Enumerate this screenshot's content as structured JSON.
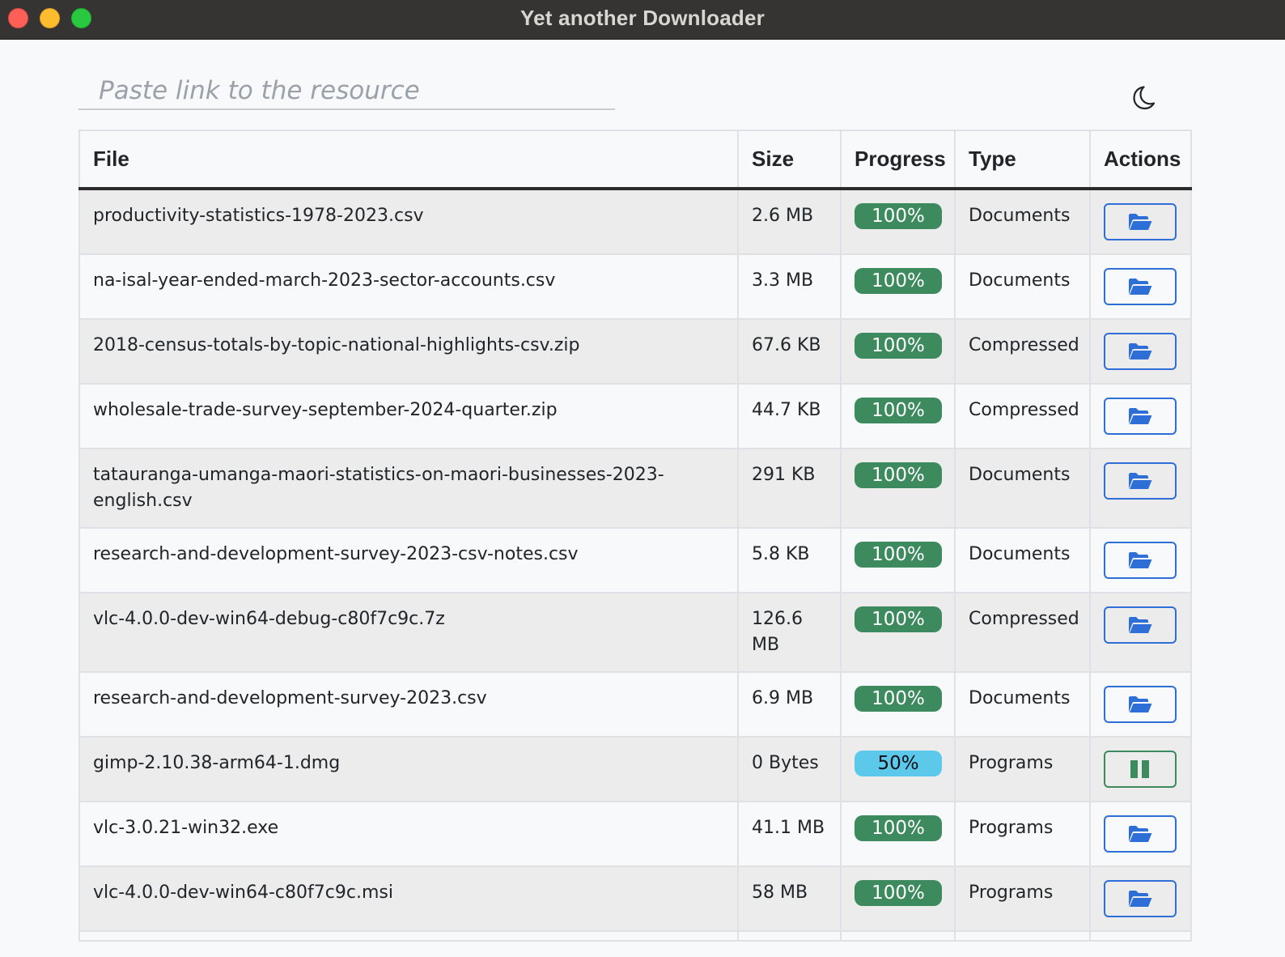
{
  "window": {
    "title": "Yet another Downloader"
  },
  "url_input": {
    "placeholder": "Paste link to the resource",
    "value": ""
  },
  "theme_toggle": {
    "icon": "moon-icon"
  },
  "table": {
    "columns": [
      "File",
      "Size",
      "Progress",
      "Type",
      "Actions"
    ],
    "rows": [
      {
        "file": "productivity-statistics-1978-2023.csv",
        "size": "2.6 MB",
        "progress": "100%",
        "progress_value": 100,
        "type": "Documents",
        "action": "open-folder"
      },
      {
        "file": "na-isal-year-ended-march-2023-sector-accounts.csv",
        "size": "3.3 MB",
        "progress": "100%",
        "progress_value": 100,
        "type": "Documents",
        "action": "open-folder"
      },
      {
        "file": "2018-census-totals-by-topic-national-highlights-csv.zip",
        "size": "67.6 KB",
        "progress": "100%",
        "progress_value": 100,
        "type": "Compressed",
        "action": "open-folder"
      },
      {
        "file": "wholesale-trade-survey-september-2024-quarter.zip",
        "size": "44.7 KB",
        "progress": "100%",
        "progress_value": 100,
        "type": "Compressed",
        "action": "open-folder"
      },
      {
        "file": "tatauranga-umanga-maori-statistics-on-maori-businesses-2023-english.csv",
        "size": "291 KB",
        "progress": "100%",
        "progress_value": 100,
        "type": "Documents",
        "action": "open-folder"
      },
      {
        "file": "research-and-development-survey-2023-csv-notes.csv",
        "size": "5.8 KB",
        "progress": "100%",
        "progress_value": 100,
        "type": "Documents",
        "action": "open-folder"
      },
      {
        "file": "vlc-4.0.0-dev-win64-debug-c80f7c9c.7z",
        "size": "126.6 MB",
        "progress": "100%",
        "progress_value": 100,
        "type": "Compressed",
        "action": "open-folder"
      },
      {
        "file": "research-and-development-survey-2023.csv",
        "size": "6.9 MB",
        "progress": "100%",
        "progress_value": 100,
        "type": "Documents",
        "action": "open-folder"
      },
      {
        "file": "gimp-2.10.38-arm64-1.dmg",
        "size": "0 Bytes",
        "progress": "50%",
        "progress_value": 50,
        "type": "Programs",
        "action": "pause"
      },
      {
        "file": "vlc-3.0.21-win32.exe",
        "size": "41.1 MB",
        "progress": "100%",
        "progress_value": 100,
        "type": "Programs",
        "action": "open-folder"
      },
      {
        "file": "vlc-4.0.0-dev-win64-c80f7c9c.msi",
        "size": "58 MB",
        "progress": "100%",
        "progress_value": 100,
        "type": "Programs",
        "action": "open-folder"
      }
    ]
  },
  "colors": {
    "complete_badge": "#3d8a5e",
    "in_progress_badge": "#5cc8ea",
    "folder_button": "#2e6fd7",
    "pause_button": "#3d8a5e"
  }
}
